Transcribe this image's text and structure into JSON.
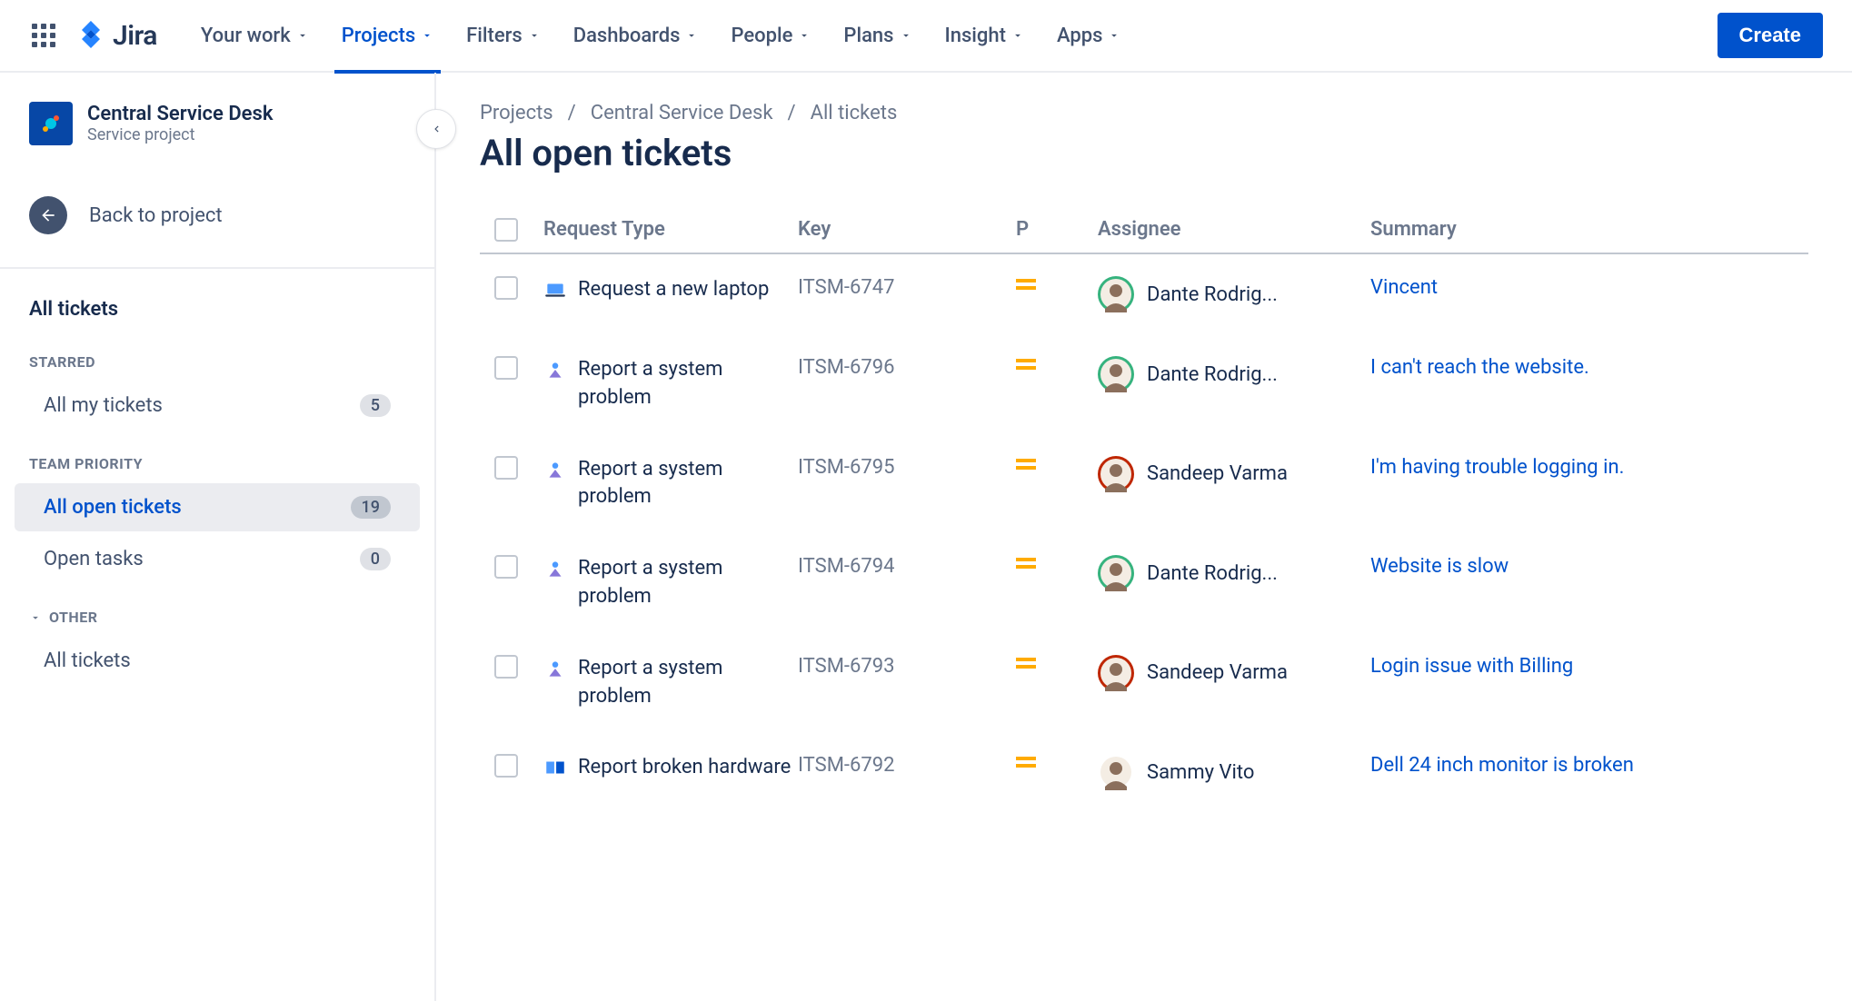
{
  "topnav": {
    "logo_text": "Jira",
    "items": [
      {
        "label": "Your work",
        "active": false
      },
      {
        "label": "Projects",
        "active": true
      },
      {
        "label": "Filters",
        "active": false
      },
      {
        "label": "Dashboards",
        "active": false
      },
      {
        "label": "People",
        "active": false
      },
      {
        "label": "Plans",
        "active": false
      },
      {
        "label": "Insight",
        "active": false
      },
      {
        "label": "Apps",
        "active": false
      }
    ],
    "create_label": "Create"
  },
  "sidebar": {
    "project_title": "Central Service Desk",
    "project_subtitle": "Service project",
    "back_label": "Back to project",
    "all_tickets_label": "All tickets",
    "sections": {
      "starred_label": "STARRED",
      "team_priority_label": "TEAM PRIORITY",
      "other_label": "OTHER"
    },
    "starred_items": [
      {
        "label": "All my tickets",
        "badge": "5"
      }
    ],
    "team_priority_items": [
      {
        "label": "All open tickets",
        "badge": "19",
        "selected": true
      },
      {
        "label": "Open tasks",
        "badge": "0"
      }
    ],
    "other_items": [
      {
        "label": "All tickets"
      }
    ]
  },
  "breadcrumb": {
    "projects": "Projects",
    "project": "Central Service Desk",
    "page": "All tickets"
  },
  "page_title": "All open tickets",
  "columns": {
    "request_type": "Request Type",
    "key": "Key",
    "priority": "P",
    "assignee": "Assignee",
    "summary": "Summary"
  },
  "rows": [
    {
      "type": "Request a new laptop",
      "type_icon": "laptop",
      "key": "ITSM-6747",
      "assignee": "Dante Rodrig...",
      "avatar_color": "#4C9AFF",
      "avatar_ring": "#36B37E",
      "summary": "Vincent"
    },
    {
      "type": "Report a system problem",
      "type_icon": "system",
      "key": "ITSM-6796",
      "assignee": "Dante Rodrig...",
      "avatar_color": "#4C9AFF",
      "avatar_ring": "#36B37E",
      "summary": "I can't reach the website."
    },
    {
      "type": "Report a system problem",
      "type_icon": "system",
      "key": "ITSM-6795",
      "assignee": "Sandeep Varma",
      "avatar_color": "#BF2600",
      "avatar_ring": "#BF2600",
      "summary": "I'm having trouble logging in."
    },
    {
      "type": "Report a system problem",
      "type_icon": "system",
      "key": "ITSM-6794",
      "assignee": "Dante Rodrig...",
      "avatar_color": "#4C9AFF",
      "avatar_ring": "#36B37E",
      "summary": "Website is slow"
    },
    {
      "type": "Report a system problem",
      "type_icon": "system",
      "key": "ITSM-6793",
      "assignee": "Sandeep Varma",
      "avatar_color": "#BF2600",
      "avatar_ring": "#BF2600",
      "summary": "Login issue with Billing"
    },
    {
      "type": "Report broken hardware",
      "type_icon": "hardware",
      "key": "ITSM-6792",
      "assignee": "Sammy Vito",
      "avatar_color": "#DFE1E6",
      "avatar_ring": "#fff",
      "summary": "Dell 24 inch monitor is broken"
    }
  ]
}
